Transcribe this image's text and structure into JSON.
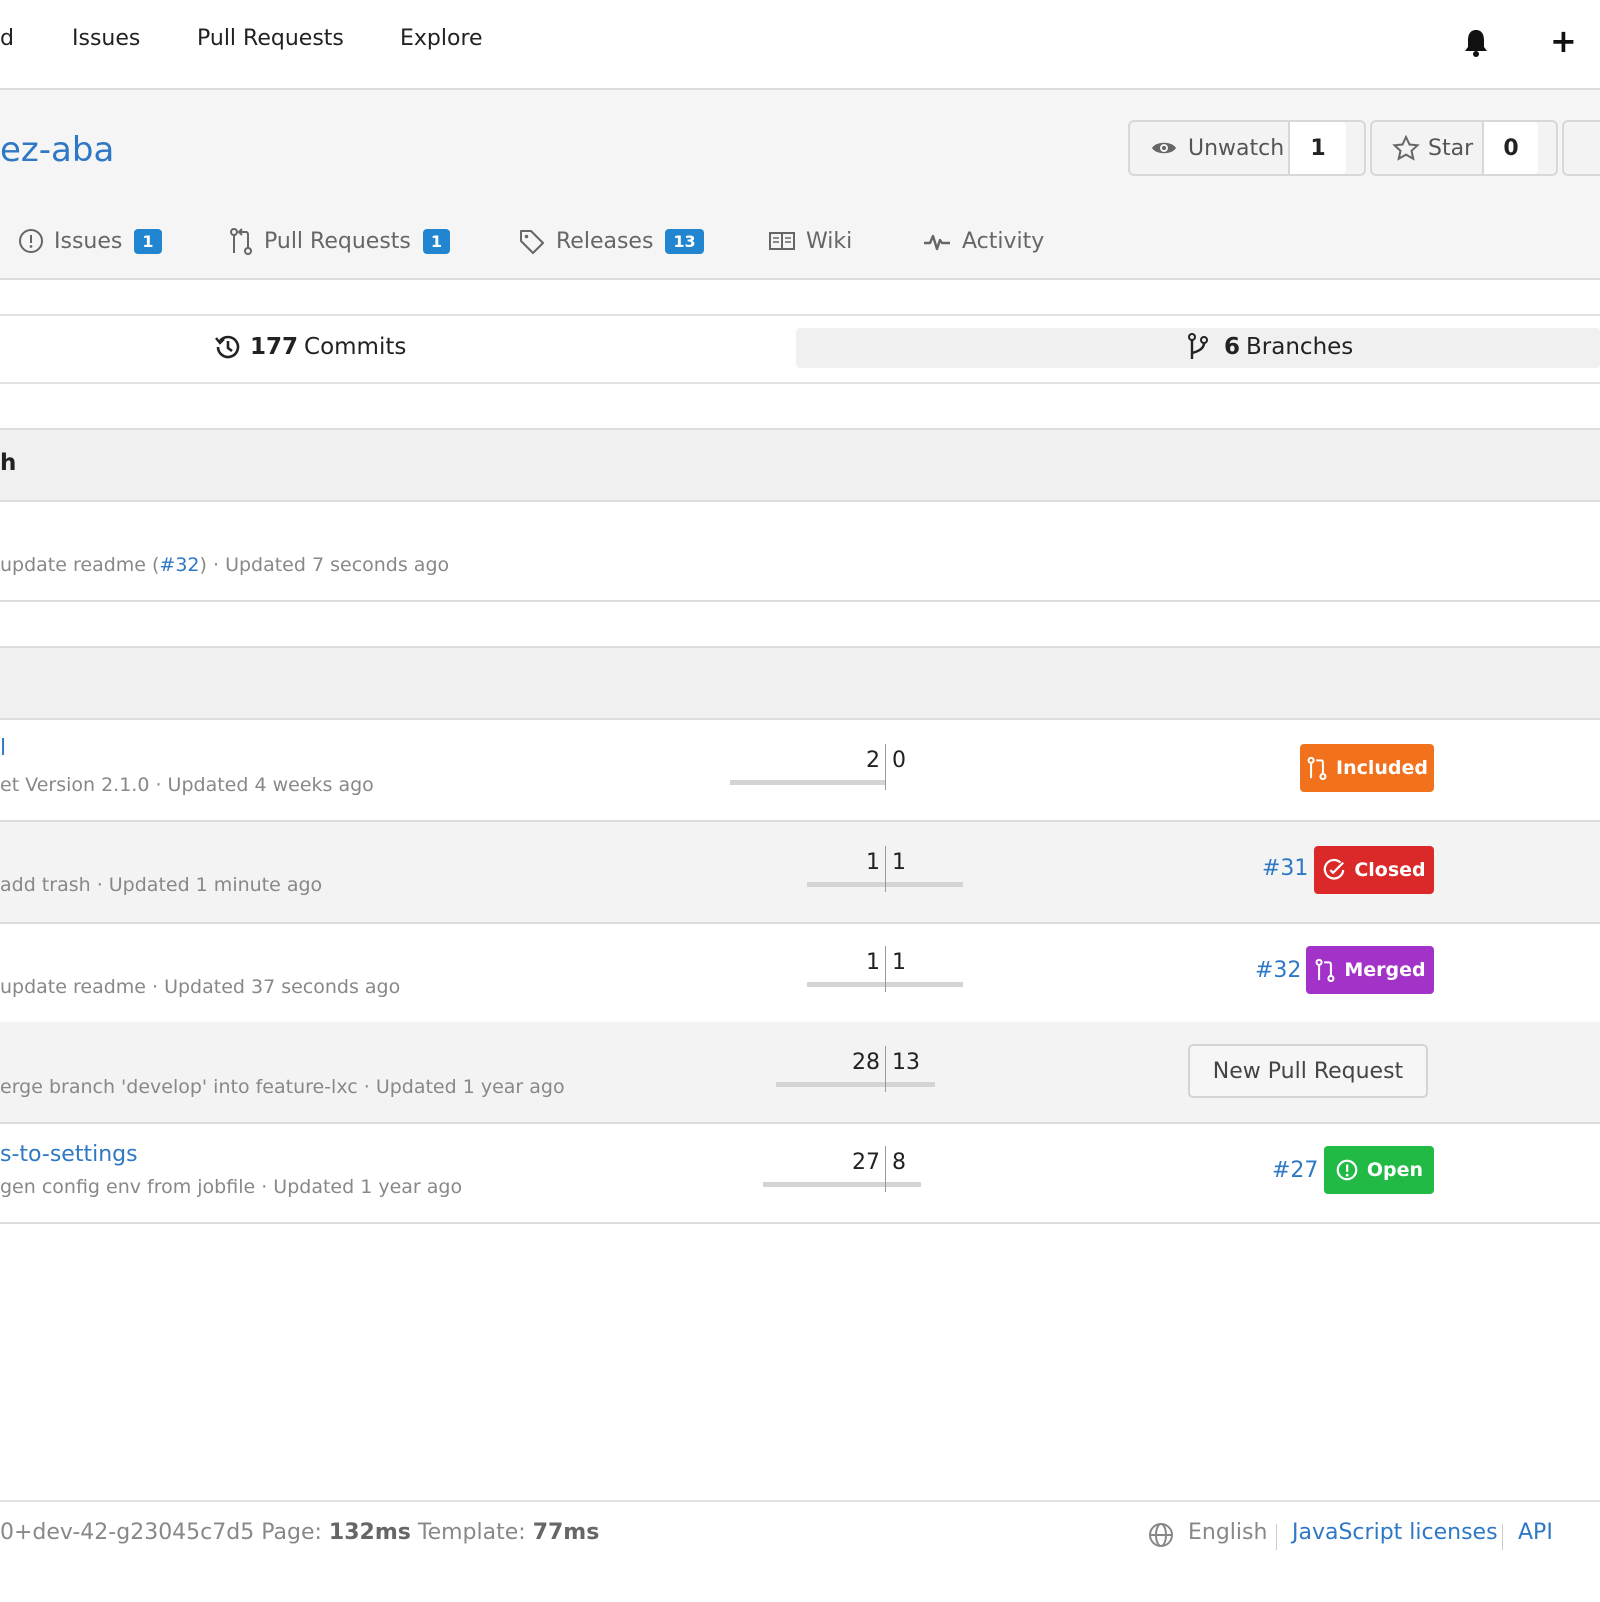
{
  "nav": {
    "partial_label": "d",
    "issues": "Issues",
    "pull_requests": "Pull Requests",
    "explore": "Explore",
    "plus": "+"
  },
  "repo": {
    "title": "ez-aba",
    "unwatch_label": "Unwatch",
    "watch_count": "1",
    "star_label": "Star",
    "star_count": "0"
  },
  "tabs": [
    {
      "label": "Issues",
      "badge": "1"
    },
    {
      "label": "Pull Requests",
      "badge": "1"
    },
    {
      "label": "Releases",
      "badge": "13"
    },
    {
      "label": "Wiki"
    },
    {
      "label": "Activity"
    }
  ],
  "stats": {
    "commits_count": "177",
    "commits_label": "Commits",
    "branches_count": "6",
    "branches_label": "Branches"
  },
  "default_branch": {
    "header": "h",
    "meta_prefix": "update readme (",
    "meta_link": "#32",
    "meta_suffix": ") · Updated 7 seconds ago"
  },
  "branches": [
    {
      "name": "l",
      "meta": "et Version 2.1.0 · Updated 4 weeks ago",
      "behind": "2",
      "ahead": "0",
      "behind_frac": 1.0,
      "ahead_frac": 0.0,
      "pr": "",
      "status": "Included"
    },
    {
      "name": "",
      "meta": "add trash · Updated 1 minute ago",
      "behind": "1",
      "ahead": "1",
      "behind_frac": 0.5,
      "ahead_frac": 0.5,
      "pr": "#31",
      "status": "Closed"
    },
    {
      "name": "",
      "meta": "update readme · Updated 37 seconds ago",
      "behind": "1",
      "ahead": "1",
      "behind_frac": 0.5,
      "ahead_frac": 0.5,
      "pr": "#32",
      "status": "Merged"
    },
    {
      "name": "",
      "meta": "erge branch 'develop' into feature-lxc · Updated 1 year ago",
      "behind": "28",
      "ahead": "13",
      "behind_frac": 0.7,
      "ahead_frac": 0.32,
      "pr": "",
      "status": "New Pull Request"
    },
    {
      "name": "s-to-settings",
      "meta": "gen config env from jobfile · Updated 1 year ago",
      "behind": "27",
      "ahead": "8",
      "behind_frac": 0.79,
      "ahead_frac": 0.23,
      "pr": "#27",
      "status": "Open"
    }
  ],
  "colors": {
    "included": "#f2711c",
    "closed": "#db2828",
    "merged": "#a333c8",
    "open": "#21ba45",
    "link": "#2e78c6",
    "badge": "#2185d0"
  },
  "footer": {
    "version": "0+dev-42-g23045c7d5",
    "page_label": "Page:",
    "page_time": "132ms",
    "template_label": "Template:",
    "template_time": "77ms",
    "language": "English",
    "licenses": "JavaScript licenses",
    "api": "API"
  }
}
